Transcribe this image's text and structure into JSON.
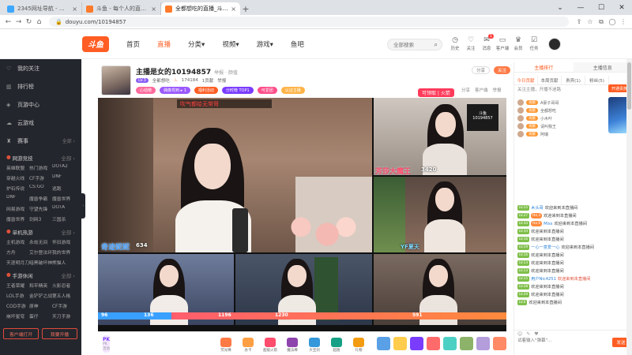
{
  "browser": {
    "tabs": [
      {
        "label": "2345网址导航 - 致力于打造百年品牌",
        "active": false
      },
      {
        "label": "斗鱼 - 每个人的直播平台",
        "active": false
      },
      {
        "label": "全都想吃的直播_斗鱼直播",
        "active": true
      }
    ],
    "url": "douyu.com/10194857"
  },
  "header": {
    "logo": "斗鱼",
    "nav": [
      "首页",
      "直播",
      "分类▾",
      "视频▾",
      "游戏▾",
      "鱼吧"
    ],
    "search_placeholder": "全部搜索",
    "icons": [
      {
        "label": "历史",
        "icon": "history-icon"
      },
      {
        "label": "关注",
        "icon": "follow-icon"
      },
      {
        "label": "消息",
        "icon": "message-icon",
        "badge": "1"
      },
      {
        "label": "客户端",
        "icon": "client-icon"
      },
      {
        "label": "会员",
        "icon": "vip-icon"
      },
      {
        "label": "任务",
        "icon": "task-icon"
      }
    ]
  },
  "sidebar": {
    "items": [
      {
        "label": "我的关注",
        "icon": "heart-icon"
      },
      {
        "label": "排行榜",
        "icon": "rank-icon"
      },
      {
        "label": "页游中心",
        "icon": "game-icon"
      },
      {
        "label": "云游戏",
        "icon": "cloud-icon"
      },
      {
        "label": "赛事",
        "icon": "trophy-icon",
        "more": "全部 ›"
      }
    ],
    "sections": [
      {
        "title": "网游竞技",
        "more": "全部 ›",
        "items": [
          "英雄联盟",
          "热门游戏",
          "DOTA2",
          "穿越火线",
          "CF手游",
          "DNF",
          "炉石传说",
          "CS:GO",
          "逃跑",
          "DNF",
          "魔兽争霸",
          "魔兽世界",
          "网易游戏",
          "守望先锋",
          "DOTA",
          "魔兽世界",
          "剑网3",
          "三国杀"
        ]
      },
      {
        "title": "单机热游",
        "more": "全部 ›",
        "items": [
          "主机游戏",
          "永劫无间",
          "怀旧游戏",
          "方舟",
          "艾尔登法环",
          "我的世界",
          "天涯明月刀",
          "暗黑破坏神",
          "熊猫人"
        ]
      },
      {
        "title": "手游休闲",
        "more": "全部 ›",
        "items": [
          "王者荣耀",
          "和平精英",
          "火影忍者",
          "LOL手游",
          "金铲铲之战",
          "第五人格",
          "COD手游",
          "原神",
          "CF手游",
          "崩坏星穹",
          "蛋仔",
          "天刀手游"
        ]
      }
    ],
    "buttons": [
      "客户端打开",
      "我要开播"
    ]
  },
  "room": {
    "title": "主播是女的10194857",
    "title_suffix": "举报 · 颜值",
    "level": "LV.3",
    "meta": [
      "全都想吃",
      "174184",
      "1贡献",
      "举报"
    ],
    "tags": [
      {
        "label": "心动榜",
        "color": "#ff6b9d"
      },
      {
        "label": "偶像驾到 ▸ 1",
        "color": "#9b59ff"
      },
      {
        "label": "福利活动",
        "color": "#ff5d23"
      },
      {
        "label": "分时榜 TOP1",
        "color": "#7a3cff"
      },
      {
        "label": "可爱团",
        "color": "#ff4f8b"
      },
      {
        "label": "认证主播",
        "color": "#ffb347"
      }
    ],
    "right_buttons": [
      "分享",
      "关注"
    ],
    "follow_button": "关注"
  },
  "player": {
    "top_danmu": "吹气都给无常哥",
    "pk_badge": "可领取 | 火箭",
    "share_labels": [
      "分享",
      "客户端",
      "举报"
    ],
    "cells": [
      {
        "name": "奇迹妮妮",
        "score": "634",
        "style": "blue"
      },
      {
        "name": "芳莎大魔王",
        "score": "3420",
        "style": "red"
      },
      {
        "name": "",
        "score": "YF夏天",
        "style": "blue"
      },
      {
        "name": "",
        "score": "1230",
        "style": "red"
      },
      {
        "name": "",
        "score": "101",
        "style": "red"
      },
      {
        "name": "",
        "score": "",
        "style": "blue"
      }
    ],
    "bar_labels": [
      "96",
      "136",
      "1196",
      "1230",
      "591"
    ]
  },
  "gifts": {
    "pk": "PK",
    "pk_sub": "PK活动",
    "items": [
      {
        "label": "荧光棒",
        "color": "#ff7a45"
      },
      {
        "label": "办卡",
        "color": "#ff9f43"
      },
      {
        "label": "超级火箭",
        "color": "#ff4d6d"
      },
      {
        "label": "魔法棒",
        "color": "#8e44ad"
      },
      {
        "label": "大宝剑",
        "color": "#3498db"
      },
      {
        "label": "超跑",
        "color": "#16a085"
      },
      {
        "label": "礼物",
        "color": "#f39c12"
      }
    ],
    "squares": [
      "#5aa0e6",
      "#ffcc4d",
      "#7a3cff",
      "#ff6b6b",
      "#4dd0c4",
      "#8cb369",
      "#b39ddb",
      "#ff8a65"
    ]
  },
  "right_panel": {
    "tabs1": [
      "主播排行",
      "主播信息"
    ],
    "tabs2": [
      "今日贡献",
      "本周贡献",
      "贵宾(1)",
      "粉丝(5)"
    ],
    "notice": "关注主播，开播不迷路",
    "vip_button": "开通贵族",
    "rank": [
      {
        "name": "A豪子哥哥",
        "badge": "贡献"
      },
      {
        "name": "全都想吃",
        "badge": "贡献"
      },
      {
        "name": "小木叶",
        "badge": "贡献"
      },
      {
        "name": "请叫我王",
        "badge": "贡献"
      },
      {
        "name": "阿瑞",
        "badge": "贡献"
      }
    ],
    "chat": [
      {
        "lv": "LV.15",
        "fans": "",
        "nick": "木头哥",
        "msg": "欢迎来到本直播间",
        "red": false
      },
      {
        "lv": "LV.27",
        "fans": "Ha 3",
        "nick": "",
        "msg": "欢迎来到本直播间",
        "red": false
      },
      {
        "lv": "LV.34",
        "fans": "Ha 6",
        "nick": "Miss",
        "msg": "欢迎来到本直播间",
        "red": false
      },
      {
        "lv": "LV.34",
        "fans": "",
        "nick": "",
        "msg": "欢迎来到本直播间",
        "red": false
      },
      {
        "lv": "LV.16",
        "fans": "",
        "nick": "",
        "msg": "欢迎来到本直播间",
        "red": false
      },
      {
        "lv": "LV.19",
        "fans": "",
        "nick": "一心一意爱一心",
        "msg": "欢迎来到本直播间",
        "red": false
      },
      {
        "lv": "LV.16",
        "fans": "",
        "nick": "",
        "msg": "欢迎来到本直播间",
        "red": false
      },
      {
        "lv": "LV.13",
        "fans": "",
        "nick": "",
        "msg": "欢迎来到本直播间",
        "red": false
      },
      {
        "lv": "LV.13",
        "fans": "",
        "nick": "",
        "msg": "欢迎来到本直播间",
        "red": false
      },
      {
        "lv": "LV.15",
        "fans": "",
        "nick": "用户Nic4251",
        "msg": "欢迎来到本直播间",
        "red": true
      },
      {
        "lv": "LV.28",
        "fans": "",
        "nick": "",
        "msg": "欢迎来到本直播间",
        "red": false
      },
      {
        "lv": "LV.29",
        "fans": "",
        "nick": "",
        "msg": "欢迎来到本直播间",
        "red": false
      },
      {
        "lv": "LV.6",
        "fans": "",
        "nick": "",
        "msg": "欢迎来到本直播间",
        "red": false
      }
    ],
    "input_placeholder": "试着输入\"弹幕\"...",
    "send_label": "发送"
  }
}
